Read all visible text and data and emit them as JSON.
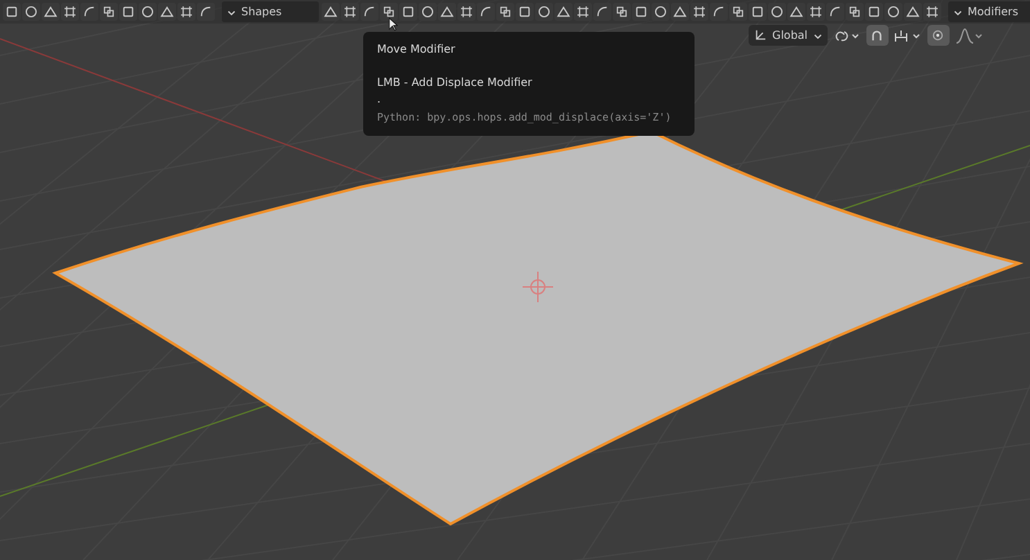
{
  "header": {
    "shapes_dropdown": {
      "label": "Shapes"
    },
    "modifiers_dropdown": {
      "label": "Modifiers"
    }
  },
  "tooltip": {
    "title": "Move Modifier",
    "lines": [
      "LMB - Add Displace Modifier",
      "."
    ],
    "python": "Python: bpy.ops.hops.add_mod_displace(axis='Z')"
  },
  "viewport_header": {
    "orientation": {
      "label": "Global"
    },
    "snap": {
      "on": true
    },
    "proportional_editing": {
      "on": true
    }
  }
}
